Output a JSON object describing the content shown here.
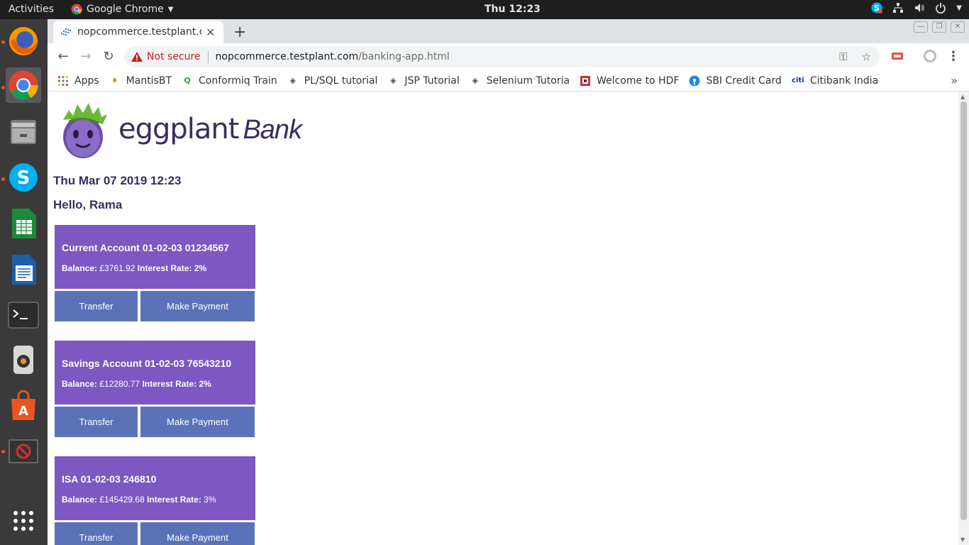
{
  "topbar": {
    "activities": "Activities",
    "app_name": "Google Chrome",
    "clock": "Thu 12:23"
  },
  "browser": {
    "tab_title": "nopcommerce.testplant.c",
    "omnibox": {
      "security_label": "Not secure",
      "url_host": "nopcommerce.testplant.com",
      "url_path": "/banking-app.html"
    },
    "bookmarks": [
      {
        "label": "Apps",
        "icon": "apps-grid-icon"
      },
      {
        "label": "MantisBT",
        "icon": "mantis-icon"
      },
      {
        "label": "Conformiq Train",
        "icon": "conformiq-icon"
      },
      {
        "label": "PL/SQL tutorial",
        "icon": "diamond-icon"
      },
      {
        "label": "JSP Tutorial",
        "icon": "diamond-icon"
      },
      {
        "label": "Selenium Tutoria",
        "icon": "diamond-icon"
      },
      {
        "label": "Welcome to HDF",
        "icon": "hdfc-icon"
      },
      {
        "label": "SBI Credit Card",
        "icon": "sbi-icon"
      },
      {
        "label": "Citibank India",
        "icon": "citi-icon"
      }
    ]
  },
  "page": {
    "logo": {
      "brand": "eggplant",
      "suffix": "Bank"
    },
    "datetime": "Thu Mar 07 2019 12:23",
    "greeting": "Hello, Rama",
    "balance_label": "Balance:",
    "rate_label": "Interest Rate:",
    "accounts": [
      {
        "title": "Current Account 01-02-03 01234567",
        "balance": "£3761.92",
        "rate": "2%",
        "transfer": "Transfer",
        "payment": "Make Payment"
      },
      {
        "title": "Savings Account 01-02-03 76543210",
        "balance": "£12280.77",
        "rate": "2%",
        "transfer": "Transfer",
        "payment": "Make Payment"
      },
      {
        "title": "ISA 01-02-03 246810",
        "balance": "£145429.68",
        "rate": "3%",
        "transfer": "Transfer",
        "payment": "Make Payment"
      }
    ]
  },
  "colors": {
    "card": "#7e57c2",
    "button": "#5b72b8",
    "heading": "#3b2d5c",
    "ubuntu_accent": "#e95420"
  }
}
